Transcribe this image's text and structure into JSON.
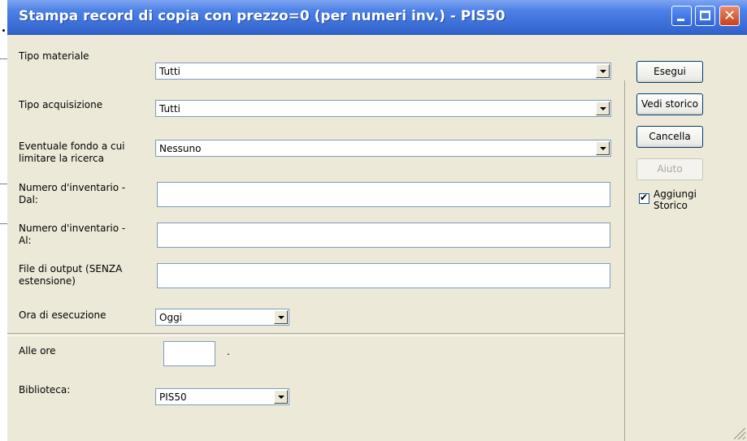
{
  "window": {
    "title": "Stampa record di copia con prezzo=0 (per numeri inv.)  - PIS50"
  },
  "form": {
    "tipo_materiale": {
      "label": "Tipo materiale",
      "value": "Tutti"
    },
    "tipo_acquisizione": {
      "label": "Tipo acquisizione",
      "value": "Tutti"
    },
    "fondo": {
      "label_line1": "Eventuale fondo a cui",
      "label_line2": "limitare la ricerca",
      "value": "Nessuno"
    },
    "inv_dal": {
      "label_line1": "Numero d'inventario -",
      "label_line2": "Dal:",
      "value": ""
    },
    "inv_al": {
      "label_line1": "Numero d'inventario -",
      "label_line2": "Al:",
      "value": ""
    },
    "file_output": {
      "label_line1": "File di output (SENZA",
      "label_line2": "estensione)",
      "value": ""
    },
    "ora_esecuzione": {
      "label": "Ora di esecuzione",
      "value": "Oggi"
    },
    "alle_ore": {
      "label": "Alle ore",
      "value": "",
      "separator": "."
    },
    "biblioteca": {
      "label": "Biblioteca:",
      "value": "PIS50"
    }
  },
  "buttons": {
    "esegui": "Esegui",
    "vedi_storico": "Vedi storico",
    "cancella": "Cancella",
    "aiuto": "Aiuto"
  },
  "checkbox": {
    "aggiungi_storico": {
      "label_line1": "Aggiungi",
      "label_line2": "Storico",
      "checked": true,
      "mark": "✔"
    }
  },
  "colors": {
    "titlebar": "#3d6fd8",
    "face": "#ece9d8",
    "button_border": "#003c74"
  }
}
